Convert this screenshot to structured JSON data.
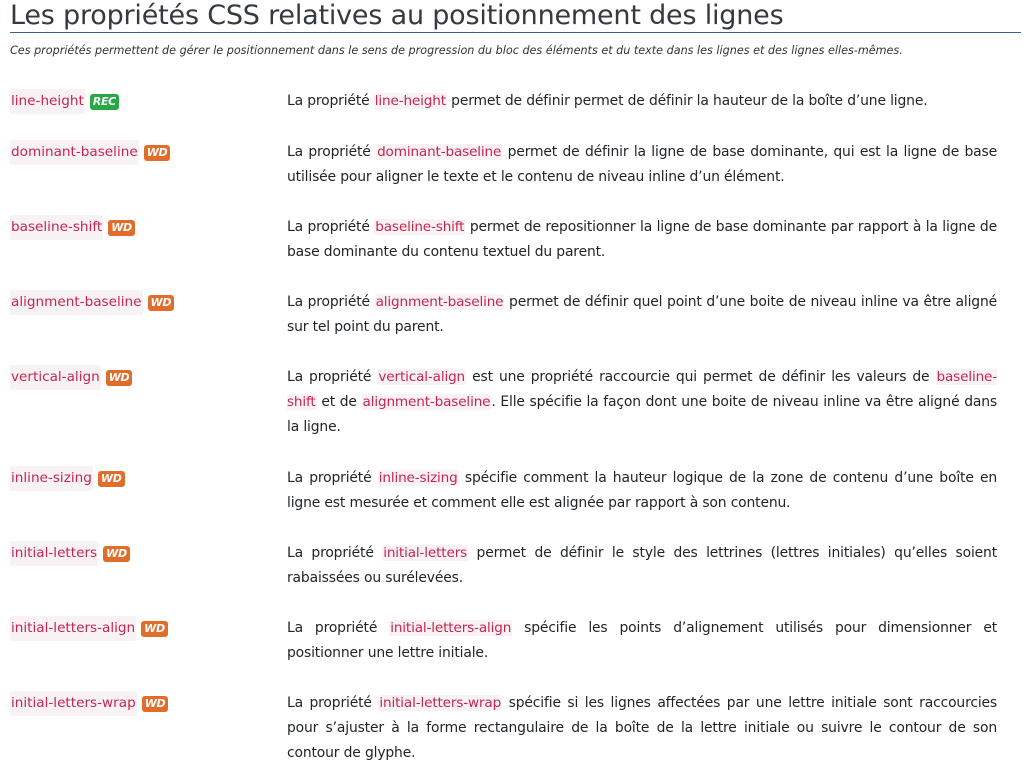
{
  "title": "Les propriétés CSS relatives au positionnement des lignes",
  "subtitle": "Ces propriétés permettent de gérer le positionnement dans le sens de progression du bloc des éléments et du texte dans les lignes et des lignes elles-mêmes.",
  "colors": {
    "rec": "#28a745",
    "wd": "#e06d2b",
    "code": "#c7254e"
  },
  "rows": [
    {
      "name": "line-height",
      "badge": "REC",
      "desc": [
        {
          "t": "La propriété "
        },
        {
          "c": "line-height"
        },
        {
          "t": " permet de définir permet de définir la hauteur de la boîte d’une ligne."
        }
      ]
    },
    {
      "name": "dominant-baseline",
      "badge": "WD",
      "desc": [
        {
          "t": "La propriété "
        },
        {
          "c": "dominant-baseline"
        },
        {
          "t": " permet de définir la ligne de base dominante, qui est la ligne de base utilisée pour aligner le texte et le contenu de niveau inline d’un élément."
        }
      ]
    },
    {
      "name": "baseline-shift",
      "badge": "WD",
      "desc": [
        {
          "t": "La propriété "
        },
        {
          "c": "baseline-shift"
        },
        {
          "t": " permet de repositionner la ligne de base dominante par rapport à la ligne de base dominante du contenu textuel du parent."
        }
      ]
    },
    {
      "name": "alignment-baseline",
      "badge": "WD",
      "desc": [
        {
          "t": "La propriété "
        },
        {
          "c": "alignment-baseline"
        },
        {
          "t": " permet de définir quel point d’une boite de niveau inline va être aligné sur tel point du parent."
        }
      ]
    },
    {
      "name": "vertical-align",
      "badge": "WD",
      "desc": [
        {
          "t": "La propriété "
        },
        {
          "c": "vertical-align"
        },
        {
          "t": " est une propriété raccourcie qui permet de définir les valeurs de "
        },
        {
          "c": "baseline-shift"
        },
        {
          "t": " et de "
        },
        {
          "c": "alignment-baseline"
        },
        {
          "t": ". Elle spécifie la façon dont une boite de niveau inline va être aligné dans la ligne."
        }
      ]
    },
    {
      "name": "inline-sizing",
      "badge": "WD",
      "desc": [
        {
          "t": "La propriété "
        },
        {
          "c": "inline-sizing"
        },
        {
          "t": " spécifie comment la hauteur logique de la zone de contenu d’une boîte en ligne est mesurée et comment elle est alignée par rapport à son contenu."
        }
      ]
    },
    {
      "name": "initial-letters",
      "badge": "WD",
      "desc": [
        {
          "t": "La propriété "
        },
        {
          "c": "initial-letters"
        },
        {
          "t": " permet de définir le style des lettrines (lettres initiales) qu’elles soient rabaissées ou surélevées."
        }
      ]
    },
    {
      "name": "initial-letters-align",
      "badge": "WD",
      "desc": [
        {
          "t": "La propriété "
        },
        {
          "c": "initial-letters-align"
        },
        {
          "t": " spécifie les points d’alignement utilisés pour dimensionner et positionner une lettre initiale."
        }
      ]
    },
    {
      "name": "initial-letters-wrap",
      "badge": "WD",
      "desc": [
        {
          "t": "La propriété "
        },
        {
          "c": "initial-letters-wrap"
        },
        {
          "t": " spécifie si les lignes affectées par une lettre initiale sont raccourcies pour s’ajuster à la forme rectangulaire de la boîte de la lettre initiale ou suivre le contour de son contour de glyphe."
        }
      ]
    }
  ]
}
